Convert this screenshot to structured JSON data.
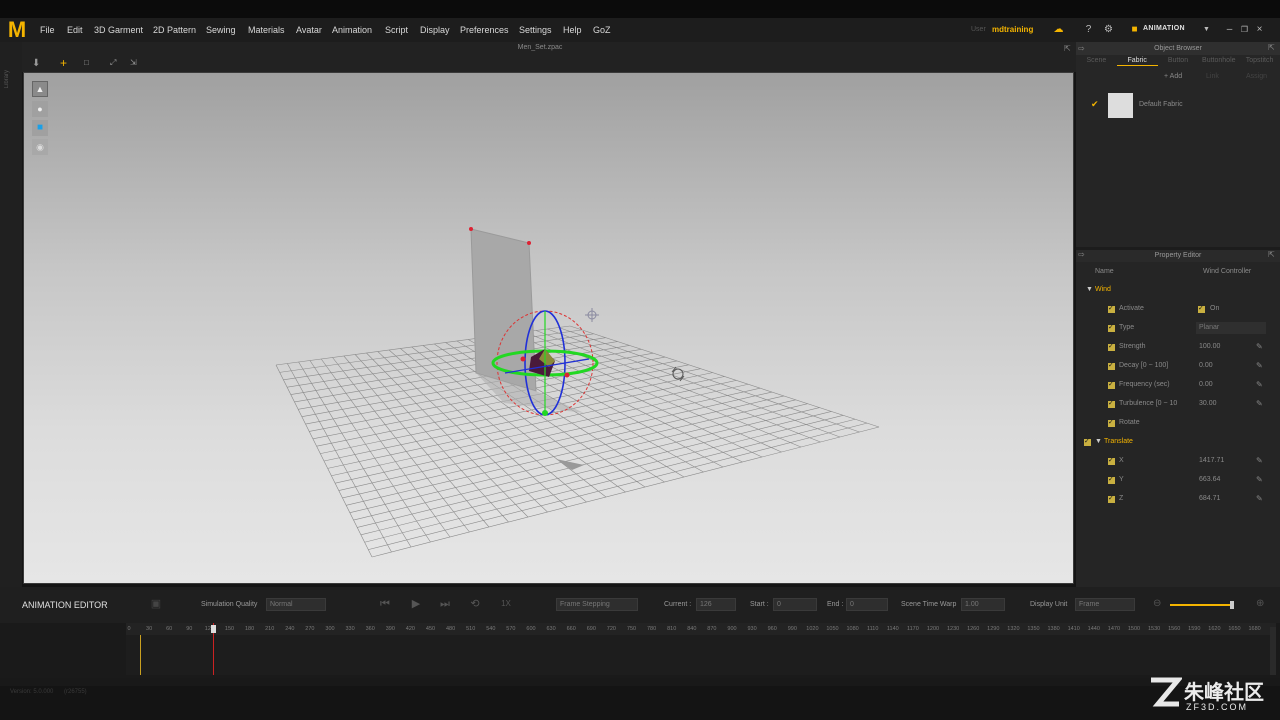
{
  "app": {
    "logo_letter": "M",
    "file_name": "Men_Set.zpac",
    "user_label": "User",
    "user_name": "mdtraining",
    "mode_label": "ANIMATION",
    "accent": "#f4b400"
  },
  "menu": [
    "File",
    "Edit",
    "3D Garment",
    "2D Pattern",
    "Sewing",
    "Materials",
    "Avatar",
    "Animation",
    "Script",
    "Display",
    "Preferences",
    "Settings",
    "Help",
    "GoZ"
  ],
  "left_strip": {
    "label": "Library"
  },
  "object_browser": {
    "title": "Object Browser",
    "tabs": [
      "Scene",
      "Fabric",
      "Button",
      "Buttonhole",
      "Topstitch"
    ],
    "active_tab": "Fabric",
    "actions": [
      "+ Add",
      "Link",
      "Assign"
    ],
    "items": [
      {
        "name": "Default Fabric",
        "checked": true
      }
    ]
  },
  "property_editor": {
    "title": "Property Editor",
    "col_name": "Name",
    "col_value": "Wind Controller",
    "wind_section": "Wind",
    "rows": [
      {
        "label": "Activate",
        "value": "On",
        "editable": false
      },
      {
        "label": "Type",
        "value": "Planar",
        "editable": false
      },
      {
        "label": "Strength",
        "value": "100.00",
        "editable": true
      },
      {
        "label": "Decay [0 ~ 100]",
        "value": "0.00",
        "editable": true
      },
      {
        "label": "Frequency (sec)",
        "value": "0.00",
        "editable": true
      },
      {
        "label": "Turbulence [0 ~ 10",
        "value": "30.00",
        "editable": true
      },
      {
        "label": "Rotate",
        "value": "",
        "editable": false
      }
    ],
    "translate_section": "Translate",
    "translate_rows": [
      {
        "label": "X",
        "value": "1417.71"
      },
      {
        "label": "Y",
        "value": "663.64"
      },
      {
        "label": "Z",
        "value": "684.71"
      }
    ]
  },
  "anim_editor": {
    "title": "ANIMATION EDITOR",
    "sim_quality_label": "Simulation Quality",
    "sim_quality_value": "Normal",
    "speed_label": "1X",
    "frame_mode": "Frame Stepping",
    "current_label": "Current :",
    "current_value": "126",
    "start_label": "Start :",
    "start_value": "0",
    "end_label": "End :",
    "end_value": "0",
    "warp_label": "Scene Time Warp",
    "warp_value": "1.00",
    "display_unit_label": "Display Unit",
    "display_unit_value": "Frame"
  },
  "timeline": {
    "ticks": [
      "0",
      "30",
      "60",
      "90",
      "120",
      "150",
      "180",
      "210",
      "240",
      "270",
      "300",
      "330",
      "360",
      "390",
      "420",
      "450",
      "480",
      "510",
      "540",
      "570",
      "600",
      "630",
      "660",
      "690",
      "720",
      "750",
      "780",
      "810",
      "840",
      "870",
      "900",
      "930",
      "960",
      "990",
      "1020",
      "1050",
      "1080",
      "1110",
      "1140",
      "1170",
      "1200",
      "1230",
      "1260",
      "1290",
      "1320",
      "1350",
      "1380",
      "1410",
      "1440",
      "1470",
      "1500",
      "1530",
      "1560",
      "1590",
      "1620",
      "1650",
      "1680"
    ],
    "current_frame": 126
  },
  "status": {
    "version": "Version: 5.0.000",
    "build": "(r26755)"
  },
  "watermark": {
    "cn": "朱峰社区",
    "url": "ZF3D.COM"
  }
}
